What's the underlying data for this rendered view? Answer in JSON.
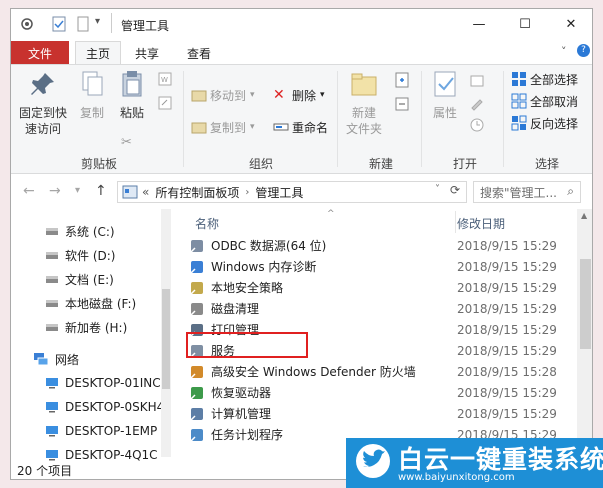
{
  "window": {
    "title": "管理工具"
  },
  "ribbon_tabs": [
    "文件",
    "主页",
    "共享",
    "查看"
  ],
  "ribbon": {
    "clipboard": {
      "pin": "固定到快\n速访问",
      "copy": "复制",
      "paste": "粘贴",
      "label": "剪贴板"
    },
    "organize": {
      "move_to": "移动到",
      "copy_to": "复制到",
      "delete": "删除",
      "rename": "重命名",
      "label": "组织"
    },
    "new": {
      "new_folder": "新建\n文件夹",
      "label": "新建"
    },
    "open": {
      "properties": "属性",
      "label": "打开"
    },
    "select": {
      "select_all": "全部选择",
      "select_none": "全部取消",
      "invert": "反向选择",
      "label": "选择"
    }
  },
  "address": {
    "prefix": "«",
    "crumb1": "所有控制面板项",
    "crumb2": "管理工具",
    "search_placeholder": "搜索\"管理工..."
  },
  "nav_items": [
    {
      "label": "系统 (C:)",
      "icon": "drive-icon"
    },
    {
      "label": "软件 (D:)",
      "icon": "drive-icon"
    },
    {
      "label": "文档 (E:)",
      "icon": "drive-icon"
    },
    {
      "label": "本地磁盘 (F:)",
      "icon": "drive-icon"
    },
    {
      "label": "新加卷 (H:)",
      "icon": "drive-icon"
    },
    {
      "label": "网络",
      "icon": "network-icon"
    },
    {
      "label": "DESKTOP-01INC",
      "icon": "computer-icon"
    },
    {
      "label": "DESKTOP-0SKH4",
      "icon": "computer-icon"
    },
    {
      "label": "DESKTOP-1EMP",
      "icon": "computer-icon"
    },
    {
      "label": "DESKTOP-4Q1C",
      "icon": "computer-icon"
    }
  ],
  "columns": {
    "name": "名称",
    "modified": "修改日期"
  },
  "files": [
    {
      "name": "ODBC 数据源(64 位)",
      "date": "2018/9/15 15:29"
    },
    {
      "name": "Windows 内存诊断",
      "date": "2018/9/15 15:29"
    },
    {
      "name": "本地安全策略",
      "date": "2018/9/15 15:29"
    },
    {
      "name": "磁盘清理",
      "date": "2018/9/15 15:29"
    },
    {
      "name": "打印管理",
      "date": "2018/9/15 15:29"
    },
    {
      "name": "服务",
      "date": "2018/9/15 15:29"
    },
    {
      "name": "高级安全 Windows Defender 防火墙",
      "date": "2018/9/15 15:28"
    },
    {
      "name": "恢复驱动器",
      "date": "2018/9/15 15:29"
    },
    {
      "name": "计算机管理",
      "date": "2018/9/15 15:29"
    },
    {
      "name": "任务计划程序",
      "date": "2018/9/15 15:29"
    }
  ],
  "status": {
    "count": "20 个项目"
  },
  "watermark": {
    "name": "白云一键重装系统",
    "url": "www.baiyunxitong.com"
  },
  "colors": {
    "file_tab": "#c8322e",
    "highlight": "#e02020",
    "watermark": "#1e8fd6"
  }
}
